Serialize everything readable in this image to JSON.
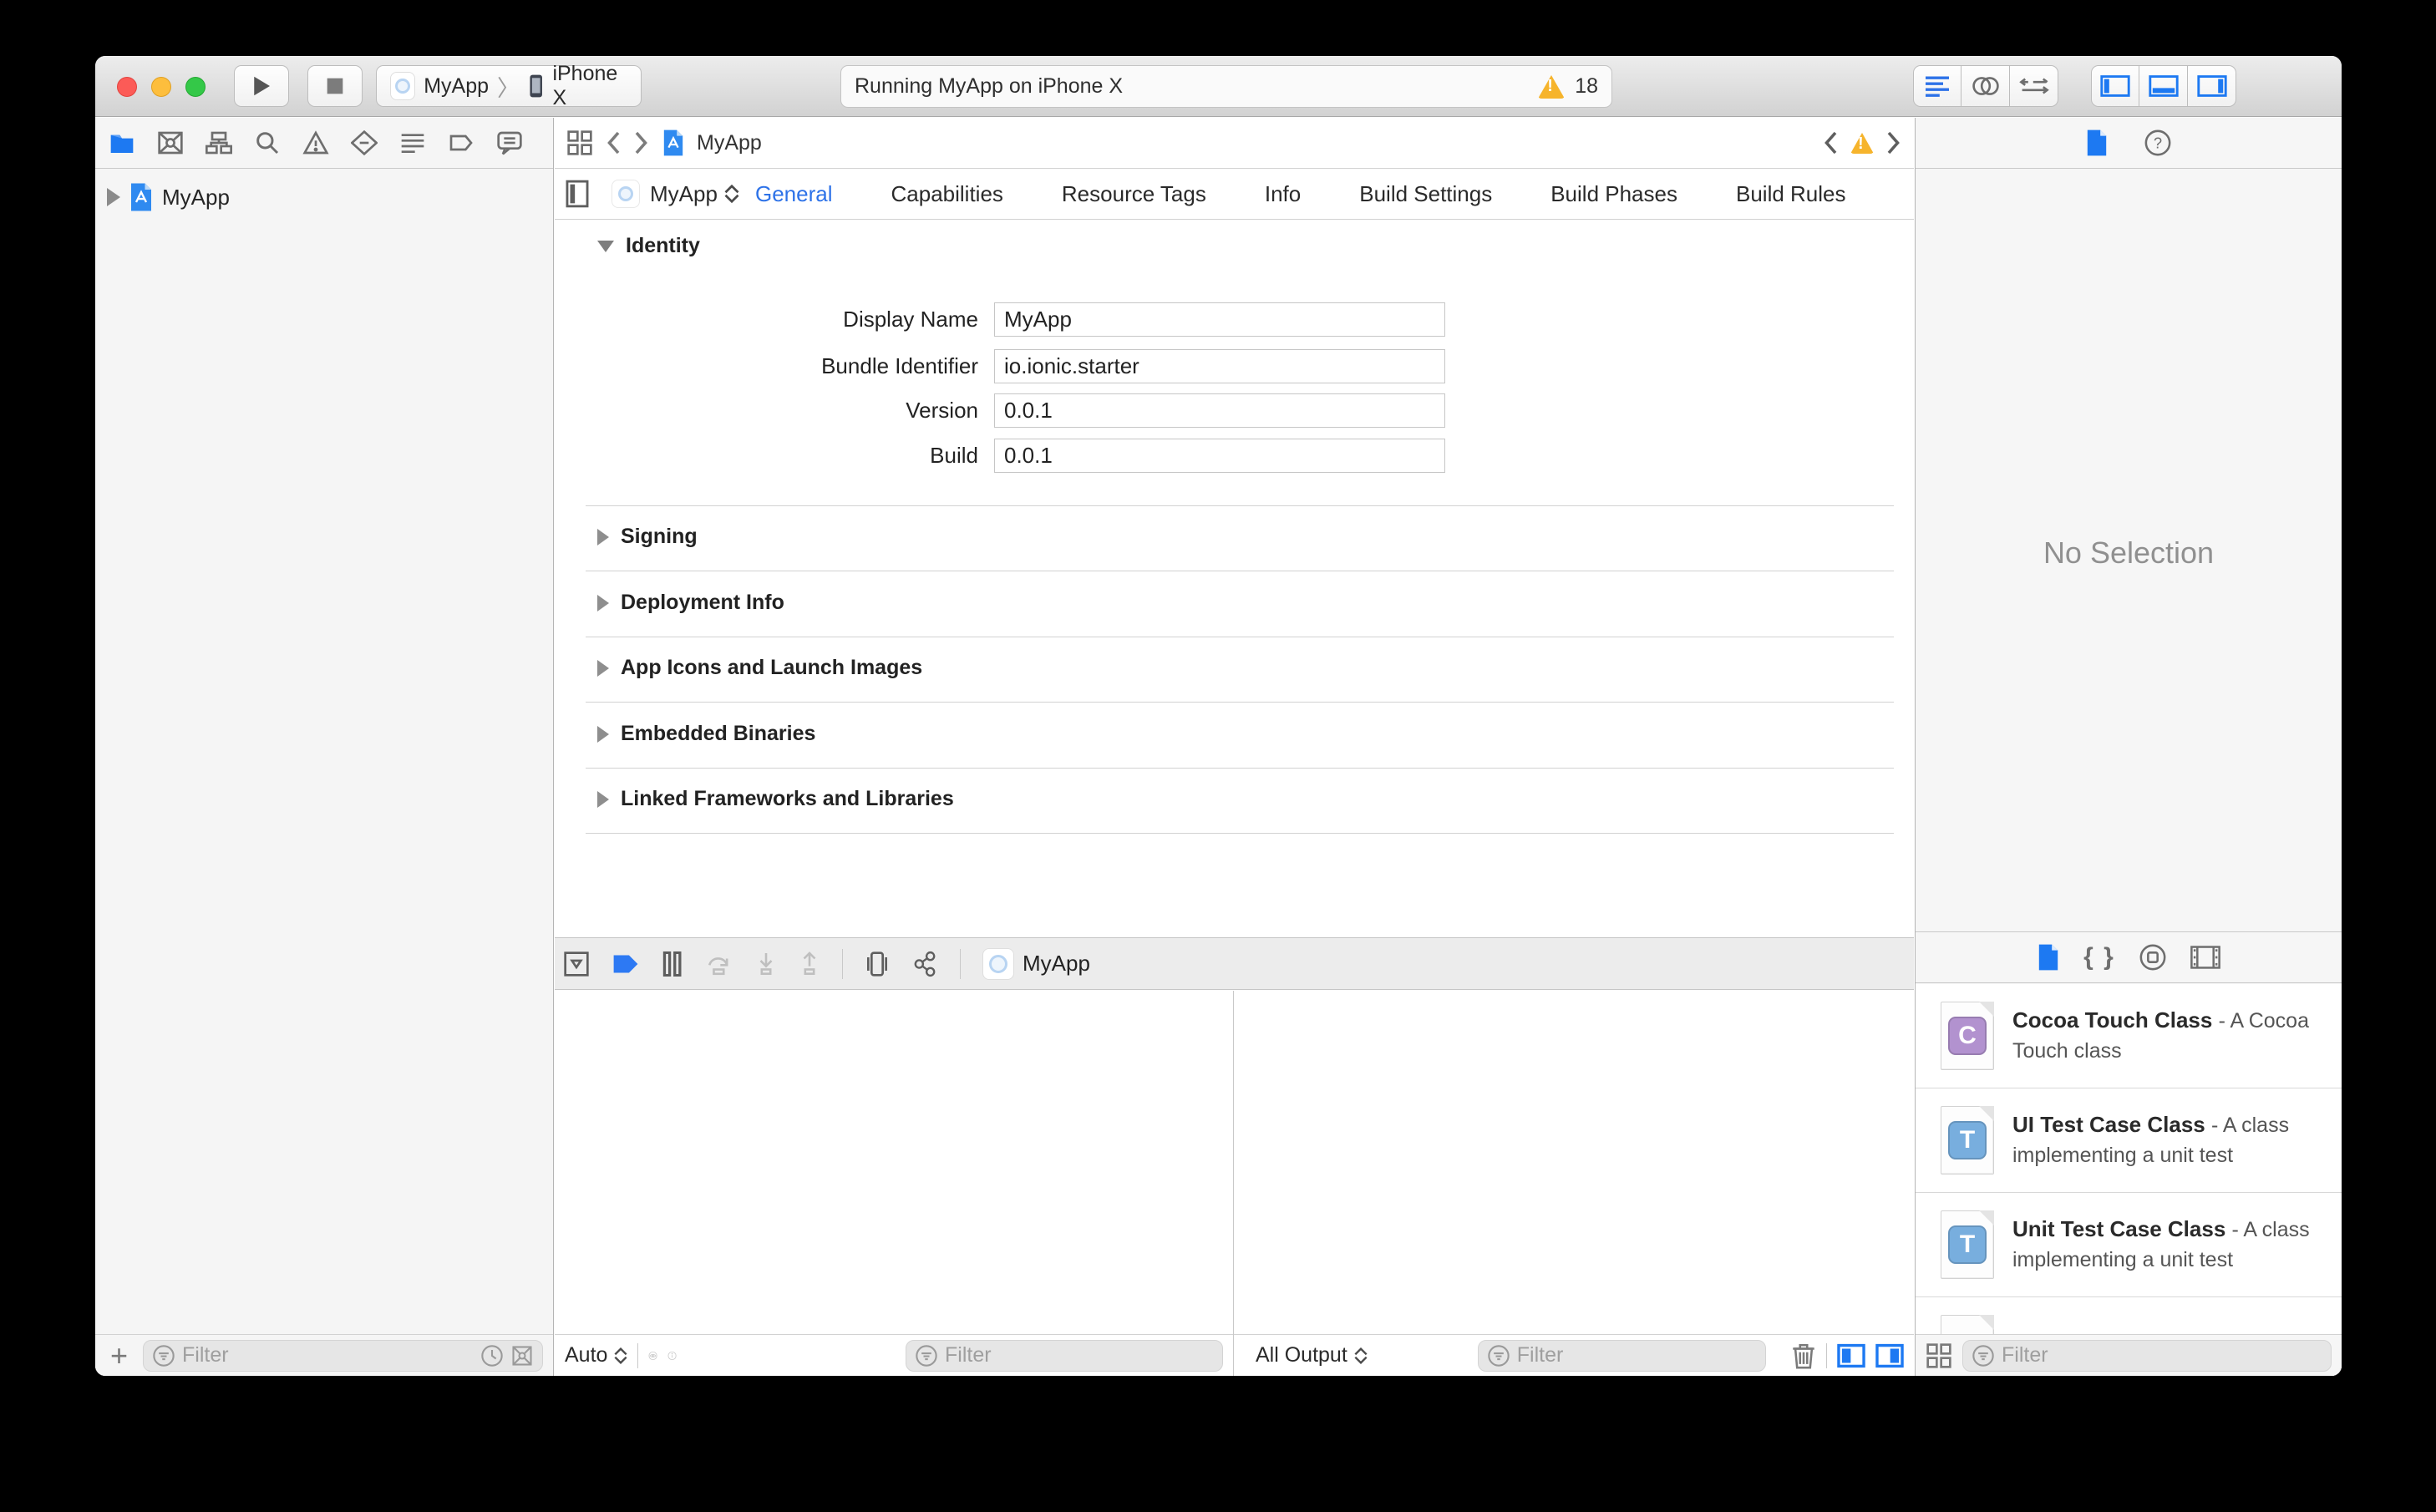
{
  "colors": {
    "accent": "#2d72e8",
    "selected_blue": "#1d79f2",
    "warning_yellow": "#f6b42c",
    "cocoa_badge": "#b292cf",
    "test_badge": "#78aede"
  },
  "icons": {
    "plus": "+",
    "braces": "{ }"
  },
  "toolbar": {
    "scheme_target": "MyApp",
    "scheme_device": "iPhone X",
    "activity_status": "Running MyApp on iPhone X",
    "warning_count": "18"
  },
  "navigator": {
    "project_item": "MyApp",
    "filter_placeholder": "Filter"
  },
  "jumpbar": {
    "file": "MyApp"
  },
  "editor": {
    "target_popup": "MyApp",
    "tabs": [
      "General",
      "Capabilities",
      "Resource Tags",
      "Info",
      "Build Settings",
      "Build Phases",
      "Build Rules"
    ],
    "identity": {
      "title": "Identity",
      "fields": [
        {
          "label": "Display Name",
          "value": "MyApp"
        },
        {
          "label": "Bundle Identifier",
          "value": "io.ionic.starter"
        },
        {
          "label": "Version",
          "value": "0.0.1"
        },
        {
          "label": "Build",
          "value": "0.0.1"
        }
      ]
    },
    "collapsed_sections": [
      "Signing",
      "Deployment Info",
      "App Icons and Launch Images",
      "Embedded Binaries",
      "Linked Frameworks and Libraries"
    ]
  },
  "debug": {
    "chip_label": "MyApp",
    "variables_scope": "Auto",
    "variables_filter_placeholder": "Filter",
    "console_scope": "All Output",
    "console_filter_placeholder": "Filter"
  },
  "inspector": {
    "no_selection": "No Selection",
    "library_items": [
      {
        "title": "Cocoa Touch Class",
        "description": "- A Cocoa Touch class",
        "badge": "C",
        "badge_color": "#b292cf"
      },
      {
        "title": "UI Test Case Class",
        "description": "- A class implementing a unit test",
        "badge": "T",
        "badge_color": "#78aede"
      },
      {
        "title": "Unit Test Case Class",
        "description": "- A class implementing a unit test",
        "badge": "T",
        "badge_color": "#78aede"
      }
    ],
    "filter_placeholder": "Filter"
  }
}
